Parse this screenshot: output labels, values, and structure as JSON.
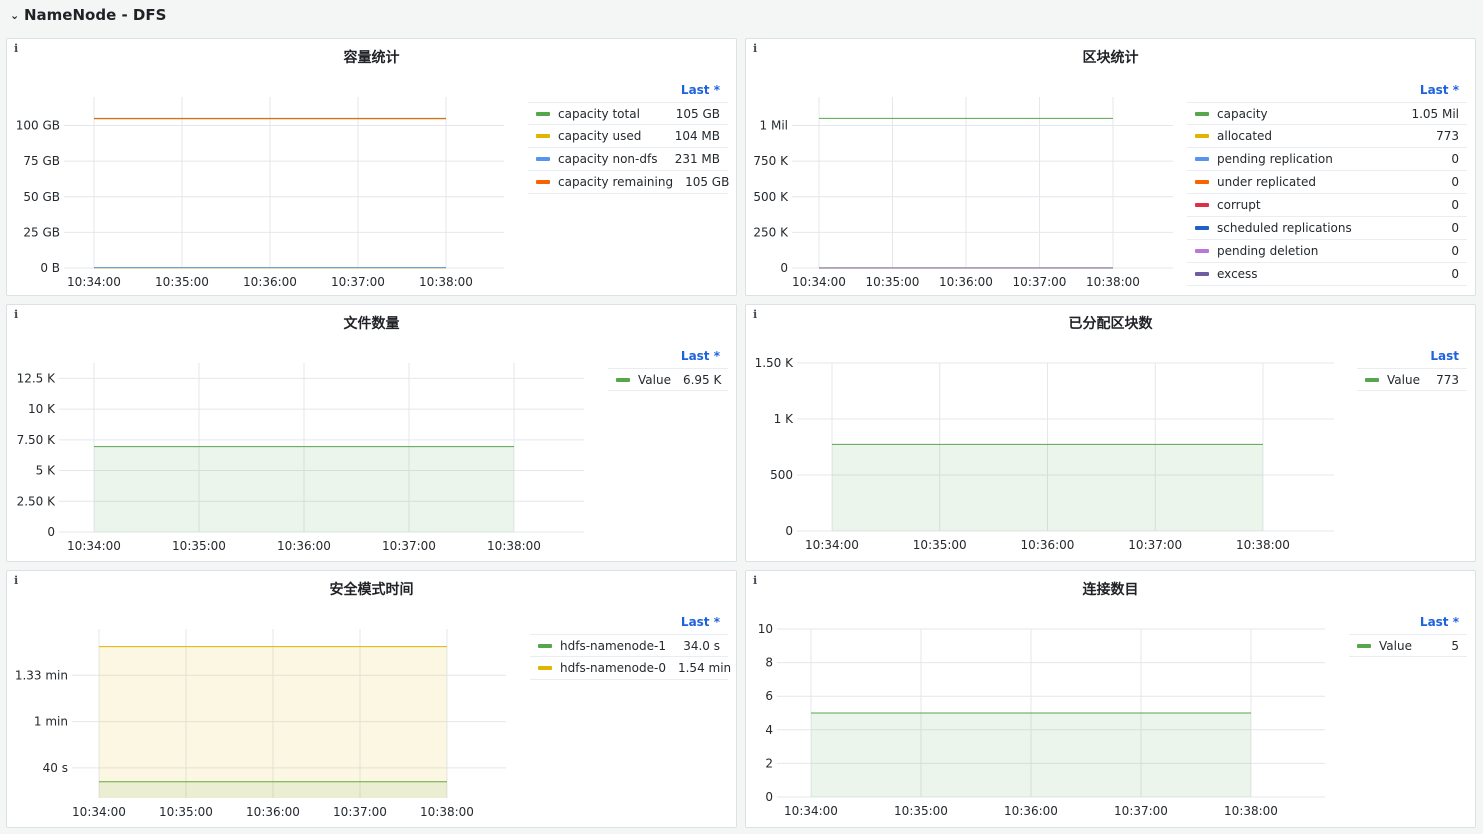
{
  "row": {
    "title": "NameNode - DFS"
  },
  "info_glyph": "i",
  "panels": [
    {
      "id": "p1",
      "title": "容量统计",
      "legend_header": "Last *",
      "chart_data": {
        "type": "line",
        "x": [
          "10:34:00",
          "10:35:00",
          "10:36:00",
          "10:37:00",
          "10:38:00"
        ],
        "yticks": [
          "0 B",
          "25 GB",
          "50 GB",
          "75 GB",
          "100 GB"
        ],
        "ylim": [
          0,
          120
        ],
        "series": [
          {
            "name": "capacity total",
            "last": "105 GB",
            "color": "#56a64b",
            "values": [
              105,
              105,
              105,
              105,
              105
            ]
          },
          {
            "name": "capacity used",
            "last": "104 MB",
            "color": "#e0b400",
            "values": [
              0.1,
              0.1,
              0.1,
              0.1,
              0.1
            ]
          },
          {
            "name": "capacity non-dfs",
            "last": "231 MB",
            "color": "#5794f2",
            "values": [
              0.23,
              0.23,
              0.23,
              0.23,
              0.23
            ]
          },
          {
            "name": "capacity remaining",
            "last": "105 GB",
            "color": "#fa6400",
            "values": [
              104.7,
              104.7,
              104.7,
              104.7,
              104.7
            ]
          }
        ]
      }
    },
    {
      "id": "p2",
      "title": "区块统计",
      "legend_header": "Last *",
      "chart_data": {
        "type": "line",
        "x": [
          "10:34:00",
          "10:35:00",
          "10:36:00",
          "10:37:00",
          "10:38:00"
        ],
        "yticks": [
          "0",
          "250 K",
          "500 K",
          "750 K",
          "1 Mil"
        ],
        "ylim": [
          0,
          1200000
        ],
        "series": [
          {
            "name": "capacity",
            "last": "1.05 Mil",
            "color": "#56a64b",
            "values": [
              1050000,
              1050000,
              1050000,
              1050000,
              1050000
            ]
          },
          {
            "name": "allocated",
            "last": "773",
            "color": "#e0b400",
            "values": [
              773,
              773,
              773,
              773,
              773
            ]
          },
          {
            "name": "pending replication",
            "last": "0",
            "color": "#5794f2",
            "values": [
              0,
              0,
              0,
              0,
              0
            ]
          },
          {
            "name": "under replicated",
            "last": "0",
            "color": "#fa6400",
            "values": [
              0,
              0,
              0,
              0,
              0
            ]
          },
          {
            "name": "corrupt",
            "last": "0",
            "color": "#e02f44",
            "values": [
              0,
              0,
              0,
              0,
              0
            ]
          },
          {
            "name": "scheduled replications",
            "last": "0",
            "color": "#1f60c4",
            "values": [
              0,
              0,
              0,
              0,
              0
            ]
          },
          {
            "name": "pending deletion",
            "last": "0",
            "color": "#b877d9",
            "values": [
              0,
              0,
              0,
              0,
              0
            ]
          },
          {
            "name": "excess",
            "last": "0",
            "color": "#705da0",
            "values": [
              0,
              0,
              0,
              0,
              0
            ]
          }
        ]
      }
    },
    {
      "id": "p3",
      "title": "文件数量",
      "legend_header": "Last *",
      "chart_data": {
        "type": "area",
        "x": [
          "10:34:00",
          "10:35:00",
          "10:36:00",
          "10:37:00",
          "10:38:00"
        ],
        "yticks": [
          "0",
          "2.50 K",
          "5 K",
          "7.50 K",
          "10 K",
          "12.5 K"
        ],
        "ylim": [
          0,
          13750
        ],
        "series": [
          {
            "name": "Value",
            "last": "6.95 K",
            "color": "#56a64b",
            "values": [
              6950,
              6950,
              6950,
              6950,
              6950
            ]
          }
        ]
      }
    },
    {
      "id": "p4",
      "title": "已分配区块数",
      "legend_header": "Last",
      "chart_data": {
        "type": "area",
        "x": [
          "10:34:00",
          "10:35:00",
          "10:36:00",
          "10:37:00",
          "10:38:00"
        ],
        "yticks": [
          "0",
          "500",
          "1 K",
          "1.50 K"
        ],
        "ylim": [
          0,
          1500
        ],
        "series": [
          {
            "name": "Value",
            "last": "773",
            "color": "#56a64b",
            "values": [
              773,
              773,
              773,
              773,
              773
            ]
          }
        ]
      }
    },
    {
      "id": "p5",
      "title": "安全模式时间",
      "legend_header": "Last *",
      "chart_data": {
        "type": "area",
        "x": [
          "10:34:00",
          "10:35:00",
          "10:36:00",
          "10:37:00",
          "10:38:00"
        ],
        "yticks": [
          "40 s",
          "1 min",
          "1.33 min"
        ],
        "ytick_values": [
          40,
          60,
          80
        ],
        "ylim": [
          27,
          100
        ],
        "series": [
          {
            "name": "hdfs-namenode-1",
            "last": "34.0 s",
            "color": "#56a64b",
            "values": [
              34,
              34,
              34,
              34,
              34
            ]
          },
          {
            "name": "hdfs-namenode-0",
            "last": "1.54 min",
            "color": "#e0b400",
            "values": [
              92.4,
              92.4,
              92.4,
              92.4,
              92.4
            ]
          }
        ]
      }
    },
    {
      "id": "p6",
      "title": "连接数目",
      "legend_header": "Last *",
      "chart_data": {
        "type": "area",
        "x": [
          "10:34:00",
          "10:35:00",
          "10:36:00",
          "10:37:00",
          "10:38:00"
        ],
        "yticks": [
          "0",
          "2",
          "4",
          "6",
          "8",
          "10"
        ],
        "ylim": [
          0,
          10
        ],
        "series": [
          {
            "name": "Value",
            "last": "5",
            "color": "#56a64b",
            "values": [
              5,
              5,
              5,
              5,
              5
            ]
          }
        ]
      }
    }
  ]
}
